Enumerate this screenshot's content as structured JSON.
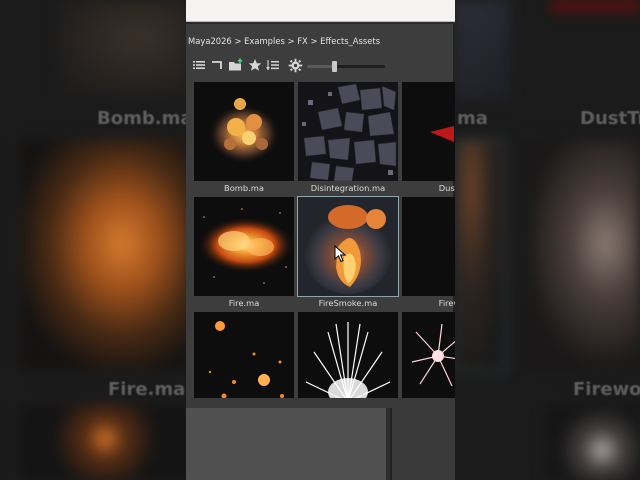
{
  "breadcrumb": [
    "Maya2026",
    ">",
    "Examples",
    ">",
    "FX",
    ">",
    "Effects_Assets"
  ],
  "toolbar": {
    "icons": [
      "list-view-icon",
      "back-arrow-icon",
      "new-folder-icon",
      "favorite-star-icon",
      "sort-list-icon",
      "settings-gear-icon"
    ],
    "thumbnail_size_slider": 0.35
  },
  "assets": [
    {
      "label": "Bomb.ma"
    },
    {
      "label": "Disintegration.ma"
    },
    {
      "label": "DustTr"
    },
    {
      "label": "Fire.ma"
    },
    {
      "label": "FireSmoke.ma"
    },
    {
      "label": "Firewo"
    },
    {
      "label": ""
    },
    {
      "label": ""
    },
    {
      "label": ""
    }
  ],
  "selected_asset": "FireSmoke.ma",
  "background": {
    "left_labels": [
      "Bomb.ma",
      "Fire.ma"
    ],
    "right_labels": [
      "DustTr",
      "Firewo"
    ],
    "middle_right_label": "ma"
  },
  "colors": {
    "panel": "#3d3d3d",
    "selection_outline": "#8fa3a8",
    "fire_orange": "#f08a2a",
    "spark_white": "#ffffff"
  }
}
